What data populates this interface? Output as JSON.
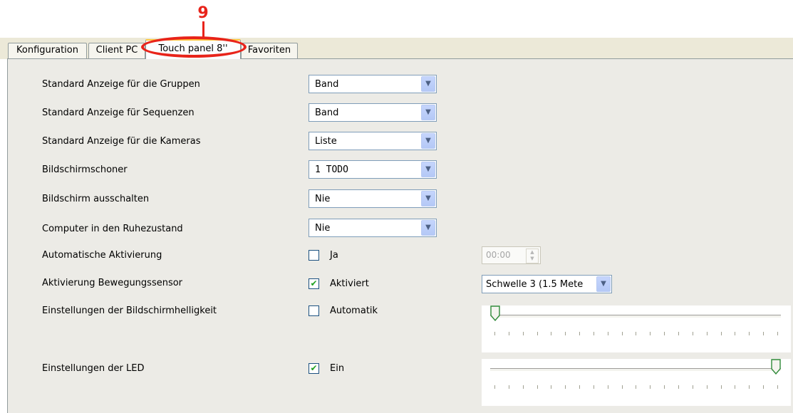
{
  "callout": {
    "number": "9",
    "color": "#e8231a"
  },
  "tabs": [
    {
      "label": "Konfiguration",
      "active": false
    },
    {
      "label": "Client PC",
      "active": false
    },
    {
      "label": "Touch panel 8''",
      "active": true
    },
    {
      "label": "Favoriten",
      "active": false
    }
  ],
  "settings": {
    "group_view": {
      "label": "Standard Anzeige für die Gruppen",
      "value": "Band"
    },
    "sequence_view": {
      "label": "Standard Anzeige für Sequenzen",
      "value": "Band"
    },
    "camera_view": {
      "label": "Standard Anzeige für die Kameras",
      "value": "Liste"
    },
    "screensaver": {
      "label": "Bildschirmschoner",
      "value": "1 TODO"
    },
    "screen_off": {
      "label": "Bildschirm ausschalten",
      "value": "Nie"
    },
    "sleep": {
      "label": "Computer in den Ruhezustand",
      "value": "Nie"
    },
    "auto_activation": {
      "label": "Automatische Aktivierung",
      "checkbox_label": "Ja",
      "checked": false,
      "time": "00:00"
    },
    "motion_sensor": {
      "label": "Aktivierung Bewegungssensor",
      "checkbox_label": "Aktiviert",
      "checked": true,
      "threshold": "Schwelle 3 (1.5 Mete"
    },
    "brightness": {
      "label": "Einstellungen der Bildschirmhelligkeit",
      "checkbox_label": "Automatik",
      "checked": false,
      "level_fraction": 0.0
    },
    "led": {
      "label": "Einstellungen der LED",
      "checkbox_label": "Ein",
      "checked": true,
      "level_fraction": 1.0
    }
  },
  "icons": {
    "dropdown": "chevron-down-icon",
    "check": "checkmark-icon",
    "spin": "spin-arrows-icon",
    "slider_thumb": "slider-thumb-icon"
  }
}
